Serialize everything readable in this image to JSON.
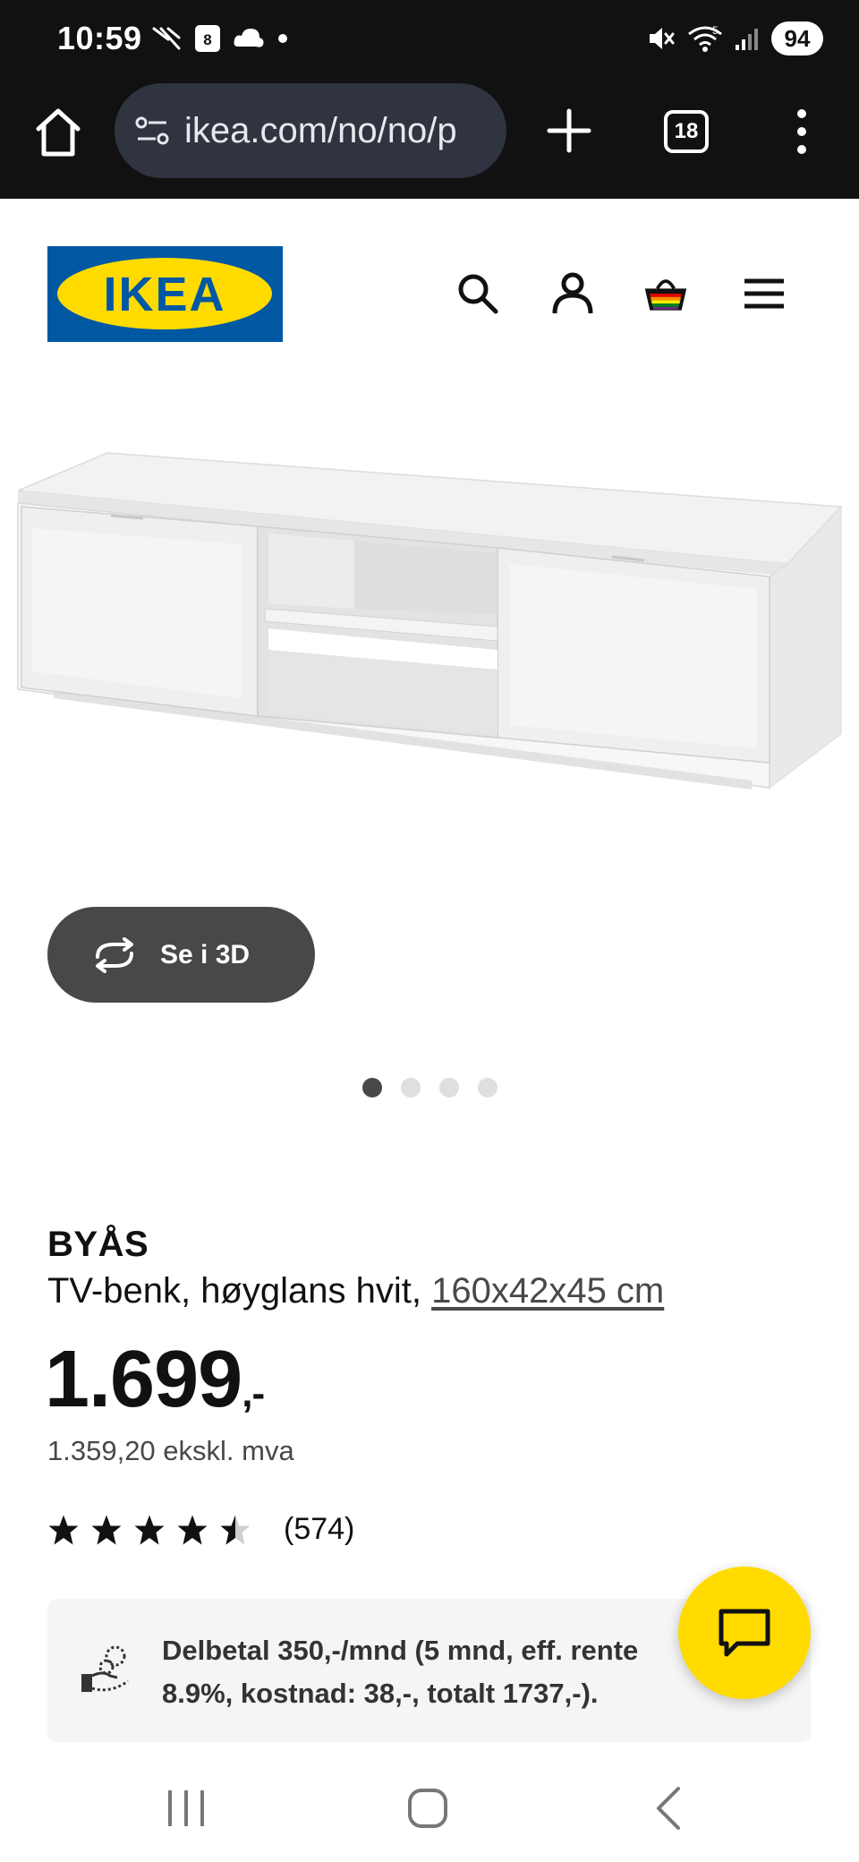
{
  "status_bar": {
    "time": "10:59",
    "calendar_day": "8",
    "battery": "94",
    "signal_label": "5"
  },
  "browser": {
    "url": "ikea.com/no/no/p",
    "tab_count": "18"
  },
  "site": {
    "logo_text": "IKEA",
    "logo_colors": {
      "background": "#0058a3",
      "ellipse": "#ffdb00",
      "text": "#0058a3"
    }
  },
  "gallery": {
    "view_3d_label": "Se i 3D",
    "dot_count": 4,
    "active_dot": 0
  },
  "product": {
    "name": "BYÅS",
    "description": "TV-benk, høyglans hvit, ",
    "size": "160x42x45 cm",
    "price": "1.699",
    "price_suffix": ",-",
    "price_ex_vat": "1.359,20 ekskl. mva",
    "rating": 4.5,
    "review_count": "(574)"
  },
  "installment": {
    "text": "Delbetal 350,-/mnd (5 mnd, eff. rente 8.9%, kostnad: 38,-, totalt 1737,-)."
  },
  "colors": {
    "accent_yellow": "#ffdb00",
    "ikea_blue": "#0058a3",
    "dark_button": "#484848"
  }
}
